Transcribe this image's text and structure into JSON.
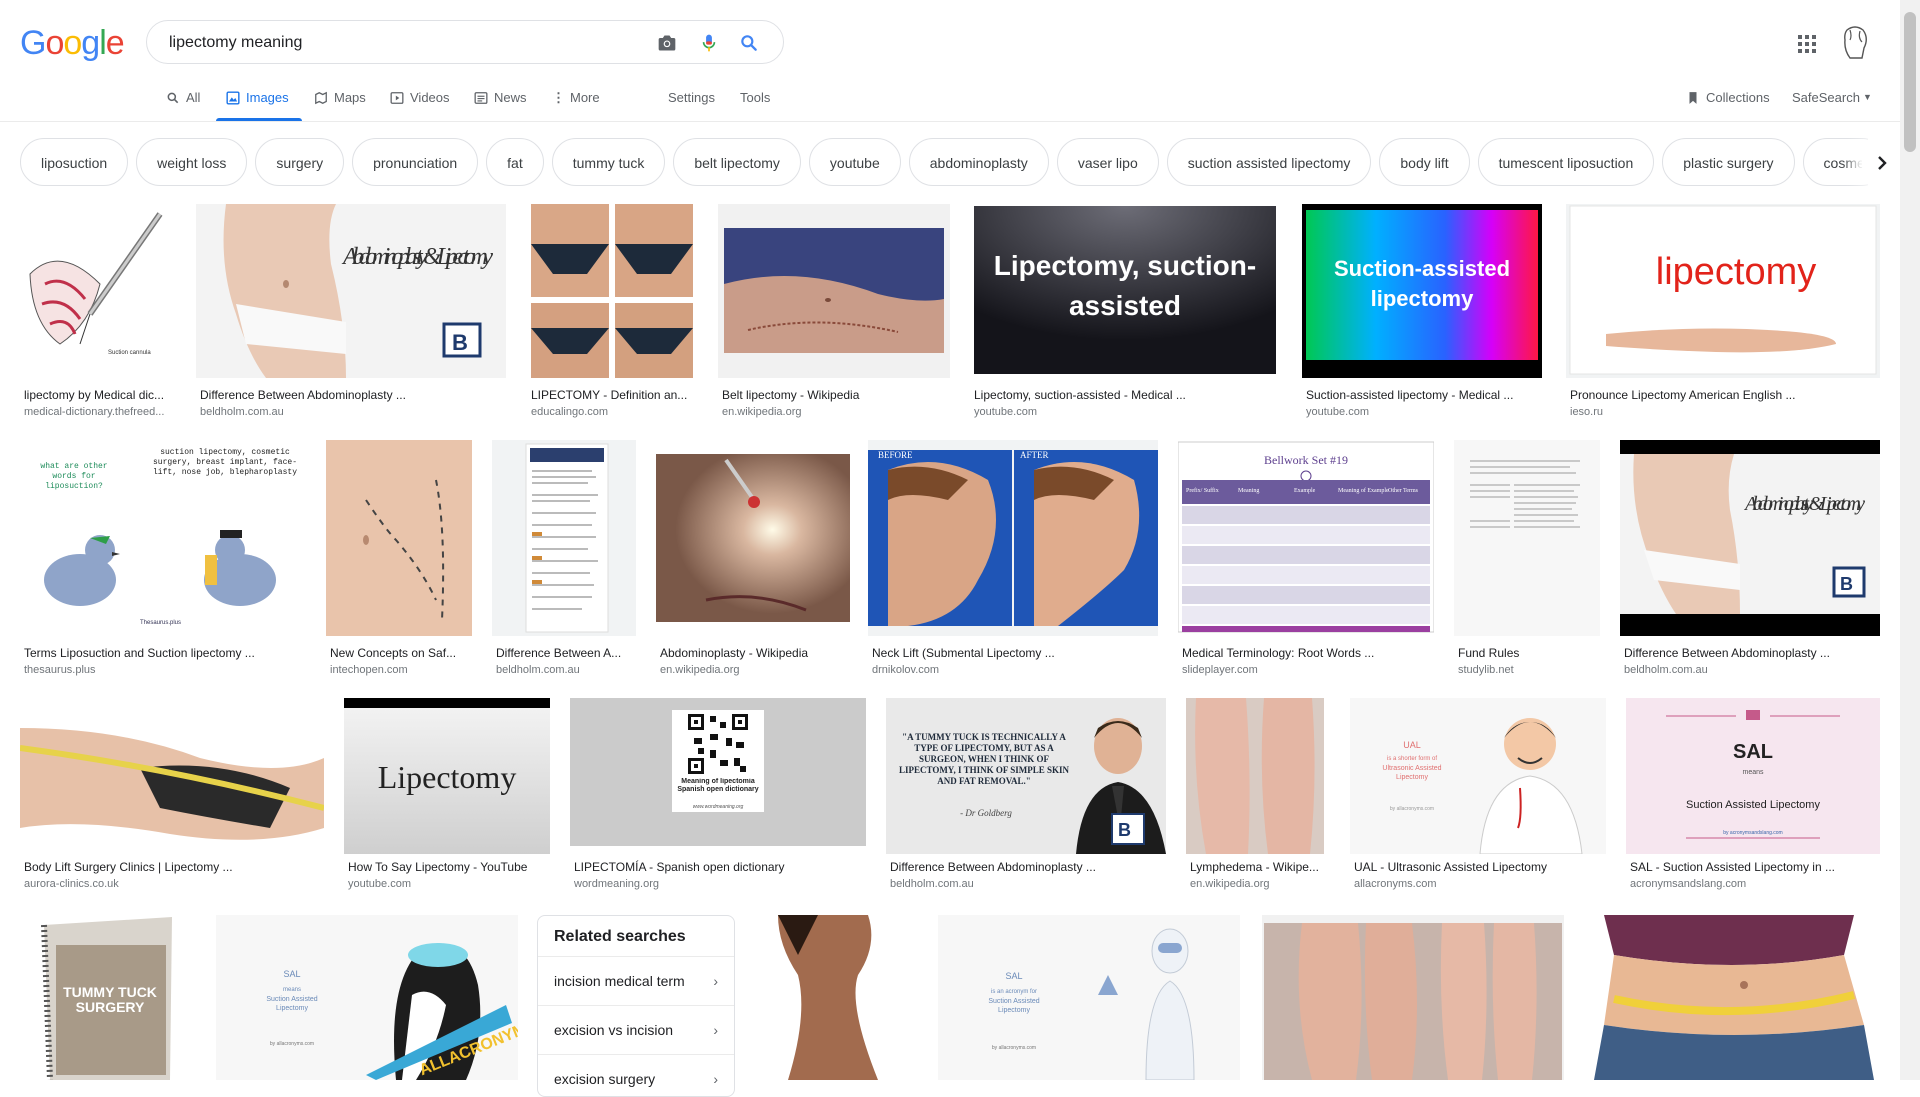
{
  "logo": "Google",
  "search": {
    "value": "lipectomy meaning"
  },
  "tabs": [
    {
      "label": "All"
    },
    {
      "label": "Images"
    },
    {
      "label": "Maps"
    },
    {
      "label": "Videos"
    },
    {
      "label": "News"
    },
    {
      "label": "More"
    },
    {
      "label": "Settings"
    },
    {
      "label": "Tools"
    }
  ],
  "right_tools": {
    "collections": "Collections",
    "safesearch": "SafeSearch"
  },
  "chips": [
    "liposuction",
    "weight loss",
    "surgery",
    "pronunciation",
    "fat",
    "tummy tuck",
    "belt lipectomy",
    "youtube",
    "abdominoplasty",
    "vaser lipo",
    "suction assisted lipectomy",
    "body lift",
    "tumescent liposuction",
    "plastic surgery",
    "cosme"
  ],
  "results": [
    {
      "caption": "lipectomy by Medical dic...",
      "source": "medical-dictionary.thefreed..."
    },
    {
      "caption": "Difference Between Abdominoplasty ...",
      "source": "beldholm.com.au"
    },
    {
      "caption": "LIPECTOMY - Definition an...",
      "source": "educalingo.com"
    },
    {
      "caption": "Belt lipectomy - Wikipedia",
      "source": "en.wikipedia.org"
    },
    {
      "caption": "Lipectomy, suction-assisted - Medical ...",
      "source": "youtube.com"
    },
    {
      "caption": "Suction-assisted lipectomy - Medical ...",
      "source": "youtube.com"
    },
    {
      "caption": "Pronounce Lipectomy American English ...",
      "source": "ieso.ru"
    },
    {
      "caption": "Terms Liposuction and Suction lipectomy ...",
      "source": "thesaurus.plus"
    },
    {
      "caption": "New Concepts on Saf...",
      "source": "intechopen.com"
    },
    {
      "caption": "Difference Between A...",
      "source": "beldholm.com.au"
    },
    {
      "caption": "Abdominoplasty - Wikipedia",
      "source": "en.wikipedia.org"
    },
    {
      "caption": "Neck Lift (Submental Lipectomy ...",
      "source": "drnikolov.com"
    },
    {
      "caption": "Medical Terminology: Root Words ...",
      "source": "slideplayer.com"
    },
    {
      "caption": "Fund Rules",
      "source": "studylib.net"
    },
    {
      "caption": "Difference Between Abdominoplasty ...",
      "source": "beldholm.com.au"
    },
    {
      "caption": "Body Lift Surgery Clinics | Lipectomy ...",
      "source": "aurora-clinics.co.uk"
    },
    {
      "caption": "How To Say Lipectomy - YouTube",
      "source": "youtube.com"
    },
    {
      "caption": "LIPECTOMÍA - Spanish open dictionary",
      "source": "wordmeaning.org"
    },
    {
      "caption": "Difference Between Abdominoplasty ...",
      "source": "beldholm.com.au"
    },
    {
      "caption": "Lymphedema - Wikipe...",
      "source": "en.wikipedia.org"
    },
    {
      "caption": "UAL - Ultrasonic Assisted Lipectomy",
      "source": "allacronyms.com"
    },
    {
      "caption": "SAL - Suction Assisted Lipectomy in ...",
      "source": "acronymsandslang.com"
    }
  ],
  "thumb_text": {
    "abdomino_script": "Abdominoplasty & Lipectomy",
    "suction_cannula": "Suction cannula",
    "lipectomy_suction": "Lipectomy, suction-assisted",
    "suction_assisted": "Suction-assisted lipectomy",
    "lipectomy_red": "lipectomy",
    "thesaurus_q": "what are other words for liposuction?",
    "thesaurus_a": "suction lipectomy, cosmetic surgery, breast implant, face-lift, nose job, blepharoplasty",
    "thesaurus_brand": "Thesaurus.plus",
    "before": "BEFORE",
    "after": "AFTER",
    "bellwork": "Bellwork Set #19",
    "bw_h1": "Prefix/ Suffix",
    "bw_h2": "Meaning",
    "bw_h3": "Example",
    "bw_h4": "Meaning of Example",
    "bw_h5": "Other Terms",
    "lipectomy_plain": "Lipectomy",
    "qr_caption": "Meaning of lipectomia Spanish open dictionary",
    "qr_url": "www.wordmeaning.org",
    "quote": "\"A TUMMY TUCK IS TECHNICALLY A TYPE OF LIPECTOMY, BUT AS A SURGEON, WHEN I THINK OF LIPECTOMY, I THINK OF SIMPLE SKIN AND FAT REMOVAL.\"",
    "quote_sig": "- Dr Goldberg",
    "ual": "UAL",
    "ual_sub": "is a shorter form of",
    "ual_full": "Ultrasonic Assisted Lipectomy",
    "ual_by": "by allacronyms.com",
    "sal": "SAL",
    "sal_means": "means",
    "sal_full": "Suction Assisted Lipectomy",
    "sal_by": "by acronymsandslang.com",
    "tummy_tuck": "TUMMY TUCK SURGERY",
    "sal2": "SAL",
    "sal2_means": "means",
    "sal2_full": "Suction Assisted Lipectomy",
    "sal2_by": "by allacronyms.com",
    "allacronyms": "ALLACRONYMS",
    "sal3": "SAL",
    "sal3_sub": "is an acronym for",
    "sal3_full": "Suction Assisted Lipectomy",
    "sal3_by": "by allacronyms.com"
  },
  "related": {
    "title": "Related searches",
    "items": [
      "incision medical term",
      "excision vs incision",
      "excision surgery"
    ]
  }
}
